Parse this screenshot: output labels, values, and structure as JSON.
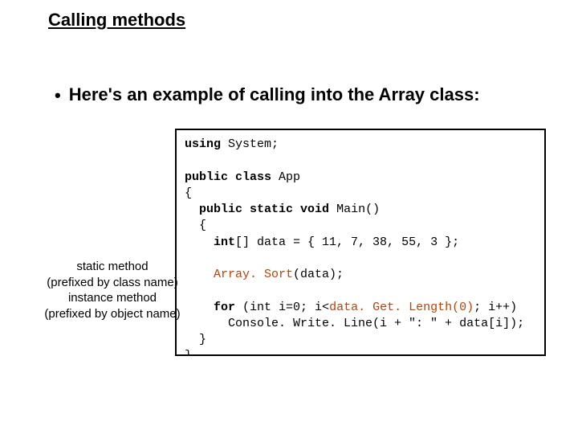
{
  "title": "Calling methods",
  "bullet": "Here's an example of calling into the Array class:",
  "notes": {
    "static1": "static method",
    "static2": "(prefixed by class name)",
    "instance1": "instance method",
    "instance2": "(prefixed by object name)"
  },
  "code": {
    "using": "using",
    "system": "System;",
    "publicClass": "public class",
    "app": "App",
    "lbrace": "{",
    "publicStaticVoid": "public static void",
    "main": "Main()",
    "intArr": "int",
    "dataDecl": "[] data = { 11, 7, 38, 55, 3 };",
    "arraySort": "Array. Sort",
    "sortArg": "(data);",
    "for": "for",
    "forCond1": "(int i=0; i<",
    "getLength": "data. Get. Length(0)",
    "forCond2": "; i++)",
    "consoleLine": "Console. Write. Line(i + \": \" + data[i]);",
    "rbrace1": "}",
    "rbrace2": "}"
  }
}
